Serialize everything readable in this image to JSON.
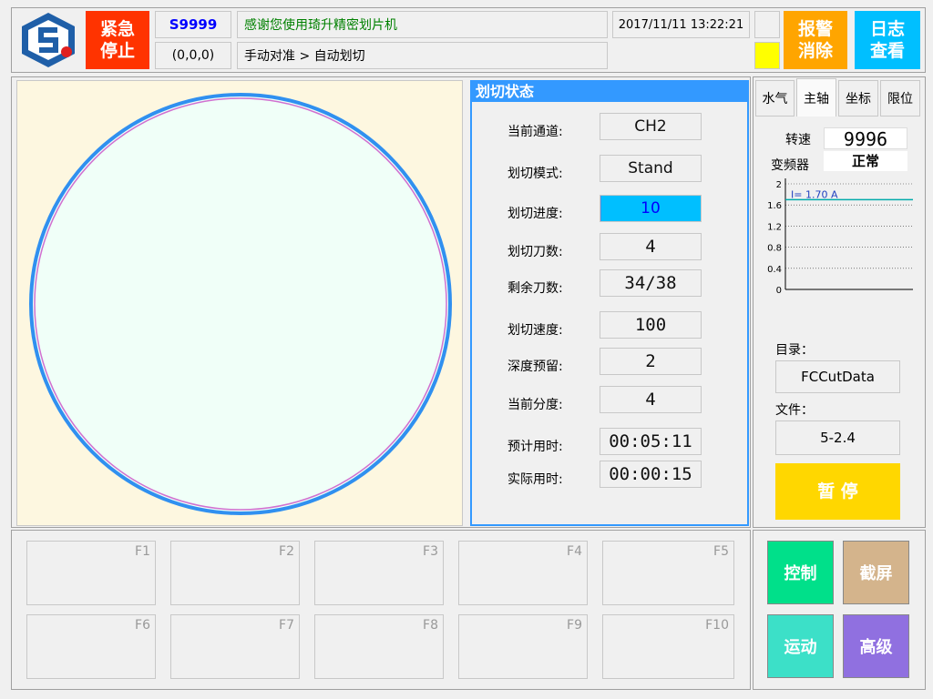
{
  "header": {
    "estop_label": "紧急\n停止",
    "program_id": "S9999",
    "coords": "(0,0,0)",
    "welcome_text": "感谢您使用琦升精密划片机",
    "breadcrumb": "手动对准 > 自动划切",
    "datetime": "2017/11/11 13:22:21",
    "alarm_clear_label": "报警\n消除",
    "log_view_label": "日志\n查看"
  },
  "status": {
    "title": "划切状态",
    "rows": [
      {
        "label": "当前通道:",
        "value": "CH2"
      },
      {
        "label": "划切模式:",
        "value": "Stand"
      },
      {
        "label": "划切进度:",
        "value": "10"
      },
      {
        "label": "划切刀数:",
        "value": "4"
      },
      {
        "label": "剩余刀数:",
        "value": "34/38"
      },
      {
        "label": "划切速度:",
        "value": "100"
      },
      {
        "label": "深度预留:",
        "value": "2"
      },
      {
        "label": "当前分度:",
        "value": "4"
      },
      {
        "label": "预计用时:",
        "value": "00:05:11"
      },
      {
        "label": "实际用时:",
        "value": "00:00:15"
      }
    ],
    "progress_fraction": 0.1
  },
  "right": {
    "tabs": [
      "水气",
      "主轴",
      "坐标",
      "限位"
    ],
    "active_tab": "主轴",
    "speed_label": "转速",
    "speed_value": "9996",
    "inverter_label": "变频器",
    "inverter_value": "正常",
    "dir_label": "目录：",
    "dir_value": "FCCutData",
    "file_label": "文件：",
    "file_value": "5-2.4",
    "pause_label": "暂 停"
  },
  "chart_data": {
    "type": "line",
    "y_ticks": [
      "2",
      "1.6",
      "1.2",
      "0.8",
      "0.4",
      "0"
    ],
    "ylim": [
      0,
      2
    ],
    "series": [
      {
        "name": "I= 1.70 A",
        "values": [
          1.7,
          1.7
        ]
      }
    ],
    "annotation": "I= 1.70 A",
    "grid": true
  },
  "fkeys": [
    "F1",
    "F2",
    "F3",
    "F4",
    "F5",
    "F6",
    "F7",
    "F8",
    "F9",
    "F10"
  ],
  "actions": [
    {
      "label": "控制",
      "color": "#00e08a"
    },
    {
      "label": "截屏",
      "color": "#d4b48c"
    },
    {
      "label": "运动",
      "color": "#3ce0c8"
    },
    {
      "label": "高级",
      "color": "#9070e0"
    }
  ],
  "colors": {
    "estop": "#ff3300",
    "program_id": "#0000ff",
    "welcome": "#008000",
    "alarm": "#ffa500",
    "log": "#00bfff",
    "indicator": "#ffff00",
    "wafer_bg": "#fdf7e0",
    "wafer_fill": "#f0fff8",
    "wafer_ring": "#3090f0",
    "status_header": "#3399ff",
    "progress": "#00bfff",
    "pause": "#ffd700"
  }
}
